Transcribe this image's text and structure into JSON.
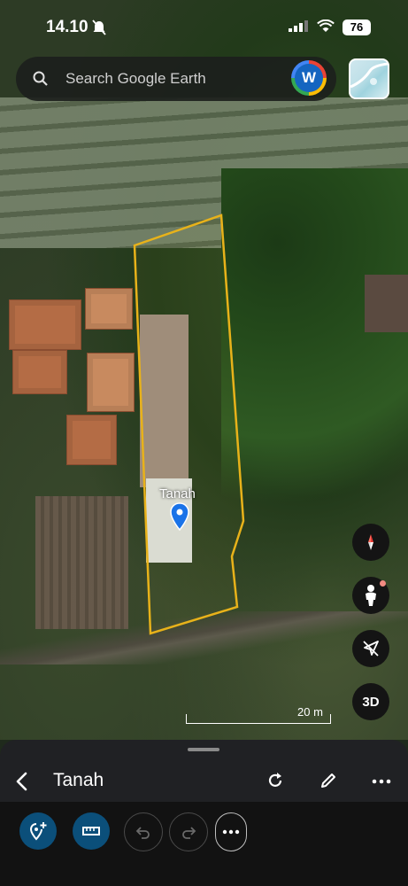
{
  "status_bar": {
    "time": "14.10",
    "battery": "76"
  },
  "search": {
    "placeholder": "Search Google Earth"
  },
  "account": {
    "initial": "W"
  },
  "map": {
    "placemark_label": "Tanah",
    "scale_label": "20 m",
    "view_mode_label": "3D",
    "polygon_color": "#e8b21a"
  },
  "bottom_sheet": {
    "title": "Tanah"
  },
  "colors": {
    "accent": "#1a73e8",
    "active_tool": "#0b4f7a",
    "sheet_bg": "#202124"
  }
}
